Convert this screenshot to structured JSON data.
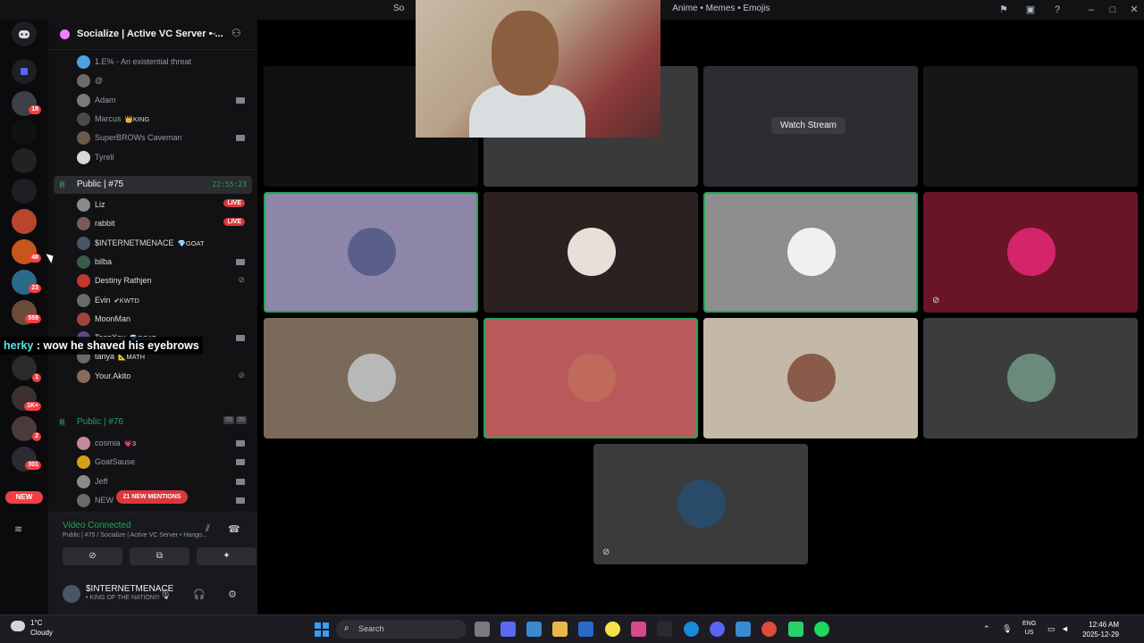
{
  "window": {
    "title_left": "So",
    "title_right": "Anime • Memes • Emojis"
  },
  "rail": {
    "badges": [
      "18",
      "48",
      "23",
      "559",
      "1",
      "1K+",
      "2",
      "301"
    ],
    "new_label": "NEW"
  },
  "server": {
    "name": "Socialize | Active VC Server • ..."
  },
  "members_top": [
    {
      "name": "1.E% - An existential threat",
      "tag": "",
      "color": "#4aa3df",
      "cam": false
    },
    {
      "name": "@",
      "tag": "",
      "color": "#6b6b6b",
      "cam": false
    },
    {
      "name": "Adam",
      "tag": "",
      "color": "#7a7a7a",
      "cam": true
    },
    {
      "name": "Marcus",
      "tag": "👑KING",
      "color": "#4a4a4a",
      "cam": false
    },
    {
      "name": "SuperBROWs Caveman",
      "tag": "",
      "color": "#6b5a4a",
      "cam": true
    },
    {
      "name": "Tyrell",
      "tag": "",
      "color": "#d8d8d8",
      "cam": false
    }
  ],
  "channel_75": {
    "name": "Public | #75",
    "timer": "22:55:23"
  },
  "members_75": [
    {
      "name": "Liz",
      "tag": "",
      "color": "#8a8a8a",
      "status": "LIVE"
    },
    {
      "name": "rabbit",
      "tag": "",
      "color": "#7a5a5a",
      "status": "LIVE"
    },
    {
      "name": "$INTERNETMENACE",
      "tag": "💎GOAT",
      "color": "#4b5563",
      "status": ""
    },
    {
      "name": "bilba",
      "tag": "",
      "color": "#3a5a4a",
      "status": "cam"
    },
    {
      "name": "Destiny Rathjen",
      "tag": "",
      "color": "#c0392b",
      "status": "muted"
    },
    {
      "name": "Evin",
      "tag": "✔KWTD",
      "color": "#6a6a6a",
      "status": ""
    },
    {
      "name": "MoonMan",
      "tag": "",
      "color": "#a0453a",
      "status": ""
    },
    {
      "name": "TacoXay",
      "tag": "💎GOAT",
      "color": "#5a4a8a",
      "status": "cam"
    },
    {
      "name": "tanya",
      "tag": "📐MATH",
      "color": "#6a6a6a",
      "status": ""
    },
    {
      "name": "Your.Akito",
      "tag": "",
      "color": "#8a6a5a",
      "status": "muted"
    }
  ],
  "channel_76": {
    "name": "Public | #76",
    "limit_a": "05",
    "limit_b": "05"
  },
  "members_76": [
    {
      "name": "cosmia",
      "tag": "💗3",
      "color": "#c08a9a"
    },
    {
      "name": "GoatSause",
      "tag": "",
      "color": "#d4a017"
    },
    {
      "name": "Jeff",
      "tag": "",
      "color": "#8a8a8a"
    },
    {
      "name": "NEW",
      "tag": "",
      "color": "#6a6a6a"
    }
  ],
  "mentions_label": "21 NEW MENTIONS",
  "voice": {
    "status": "Video Connected",
    "where": "Public | #75 / Socialize | Active VC Server • Hango..."
  },
  "user": {
    "name": "$INTERNETMENACE",
    "status": "• KING OF THE NATION!!!"
  },
  "stream": {
    "watch_label": "Watch Stream"
  },
  "caption": {
    "user": "herky",
    "text": " : wow he shaved his eyebrows"
  },
  "tiles": [
    {
      "color": "#8e86a8",
      "avatar": "#5a5f8a"
    },
    {
      "color": "#2b2120",
      "avatar": "#e8e0d8"
    },
    {
      "color": "#8e8e8e",
      "avatar": "#f0f0f0"
    },
    {
      "color": "#6a1428",
      "avatar": "#d4246b"
    },
    {
      "color": "#7a6a5a",
      "avatar": "#b8b8b8"
    },
    {
      "color": "#b85a5c",
      "avatar": "#c06a5a"
    },
    {
      "color": "#c4b8a8",
      "avatar": "#8a5a4a"
    },
    {
      "color": "#3a3c3e",
      "avatar": "#6a8a7a"
    },
    {
      "color": "#3a3b3d",
      "avatar": "#2a4a6a"
    }
  ],
  "taskbar": {
    "temp": "1°C",
    "condition": "Cloudy",
    "search_placeholder": "Search",
    "lang_top": "ENG",
    "lang_bottom": "US",
    "time": "12:46 AM",
    "date": "2025-12-29"
  }
}
